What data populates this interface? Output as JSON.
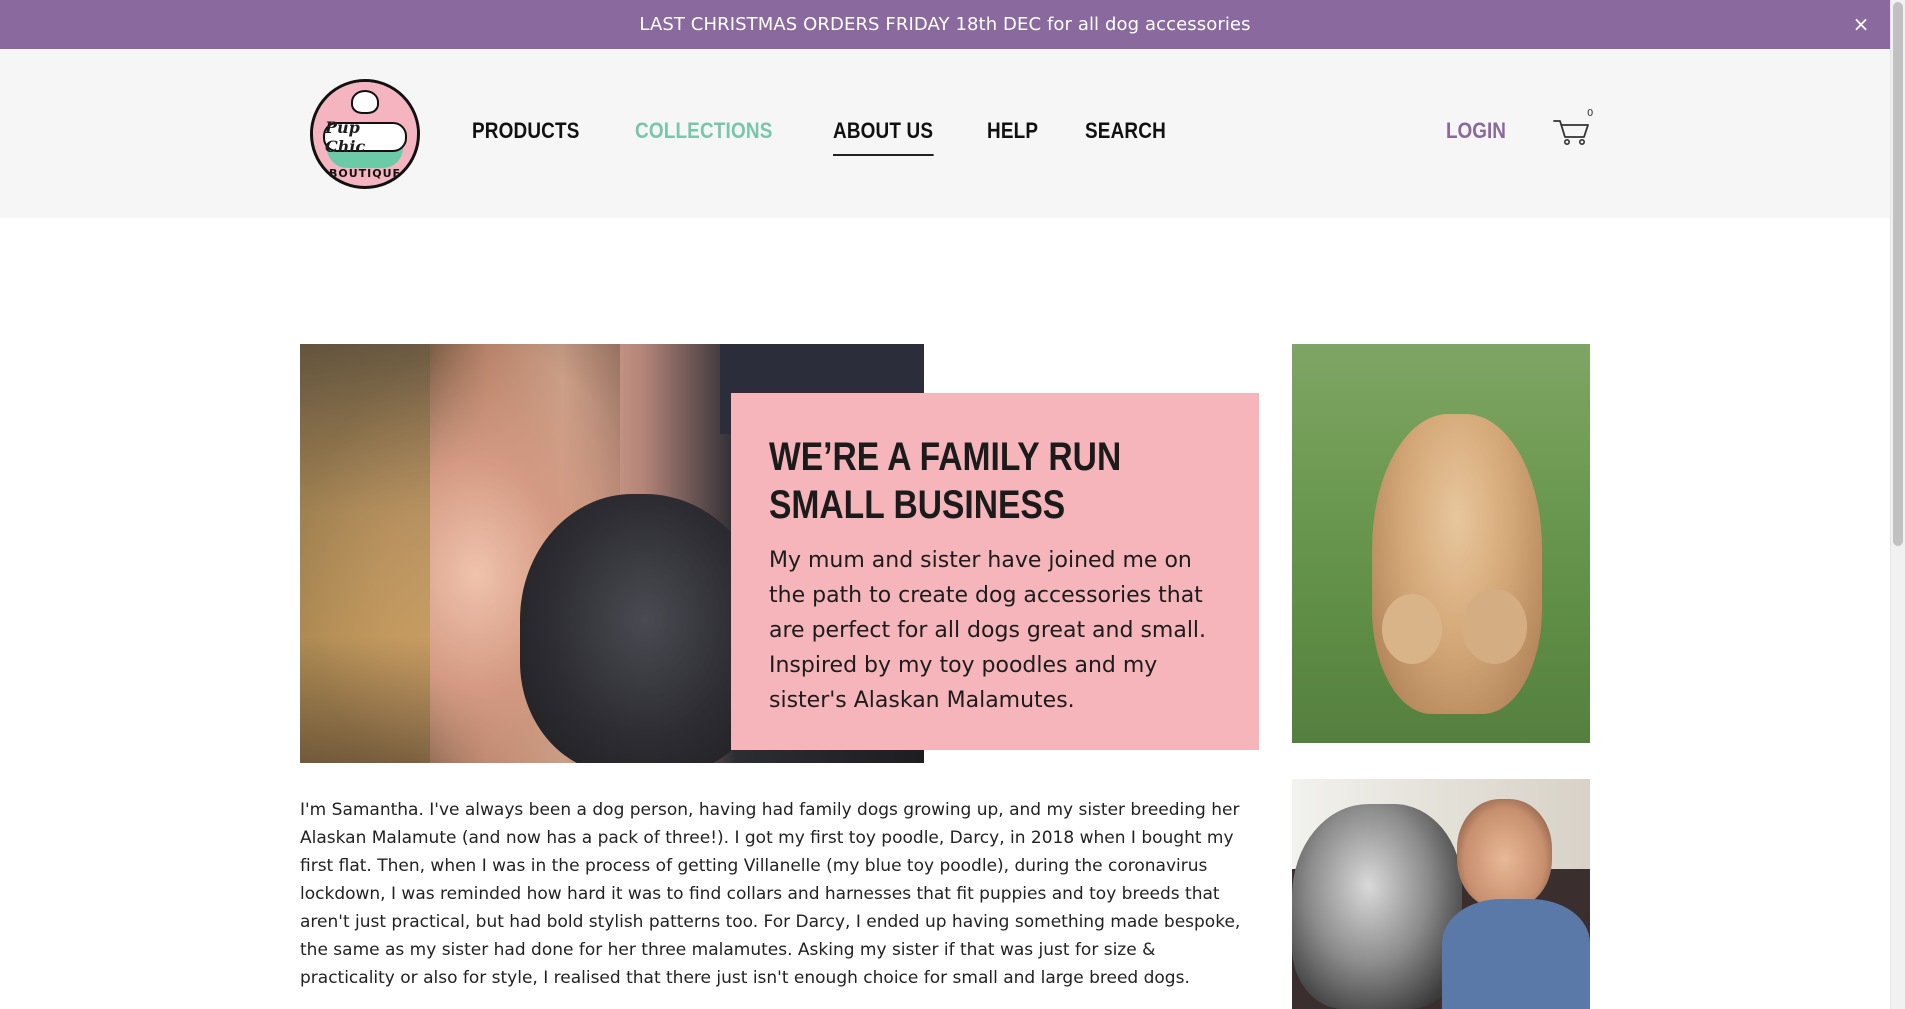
{
  "announcement": {
    "text": "LAST CHRISTMAS ORDERS FRIDAY 18th DEC for all dog accessories",
    "close_glyph": "×"
  },
  "logo": {
    "brand_line1": "Pup Chic",
    "brand_line2": "BOUTIQUE"
  },
  "nav": {
    "items": [
      {
        "label": "PRODUCTS"
      },
      {
        "label": "COLLECTIONS"
      },
      {
        "label": "ABOUT US"
      },
      {
        "label": "HELP"
      },
      {
        "label": "SEARCH"
      }
    ],
    "active": "ABOUT US",
    "accent_item": "COLLECTIONS",
    "login_label": "LOGIN",
    "cart_count": "0"
  },
  "hero": {
    "title": "WE’RE A FAMILY RUN SMALL BUSINESS",
    "text": "My mum and sister have joined me on the path to create dog accessories that are perfect for all dogs great and small. Inspired by my toy poodles and my sister's Alaskan Malamutes."
  },
  "story": {
    "text": "I'm Samantha. I've always been a dog person, having had family dogs growing up, and my sister breeding her Alaskan Malamute (and now has a pack of three!). I got my first toy poodle, Darcy, in 2018 when I bought my first flat. Then, when I was in the process of getting Villanelle (my blue toy poodle), during the coronavirus lockdown, I was reminded how hard it was to find collars and harnesses that fit puppies and toy breeds that aren't just practical, but had bold stylish patterns too. For Darcy, I ended up having something made bespoke, the same as my sister had done for her three malamutes. Asking my sister if that was just for size & practicality or also for style, I realised that there just isn't enough choice for small and large breed dogs."
  },
  "colors": {
    "announcement_bg": "#8a6a9e",
    "header_bg": "#f6f6f6",
    "accent_mint": "#79c6ad",
    "card_pink": "#f5b5bb",
    "login_purple": "#8a6a9e"
  },
  "icons": {
    "close": "close-icon",
    "cart": "cart-icon"
  }
}
